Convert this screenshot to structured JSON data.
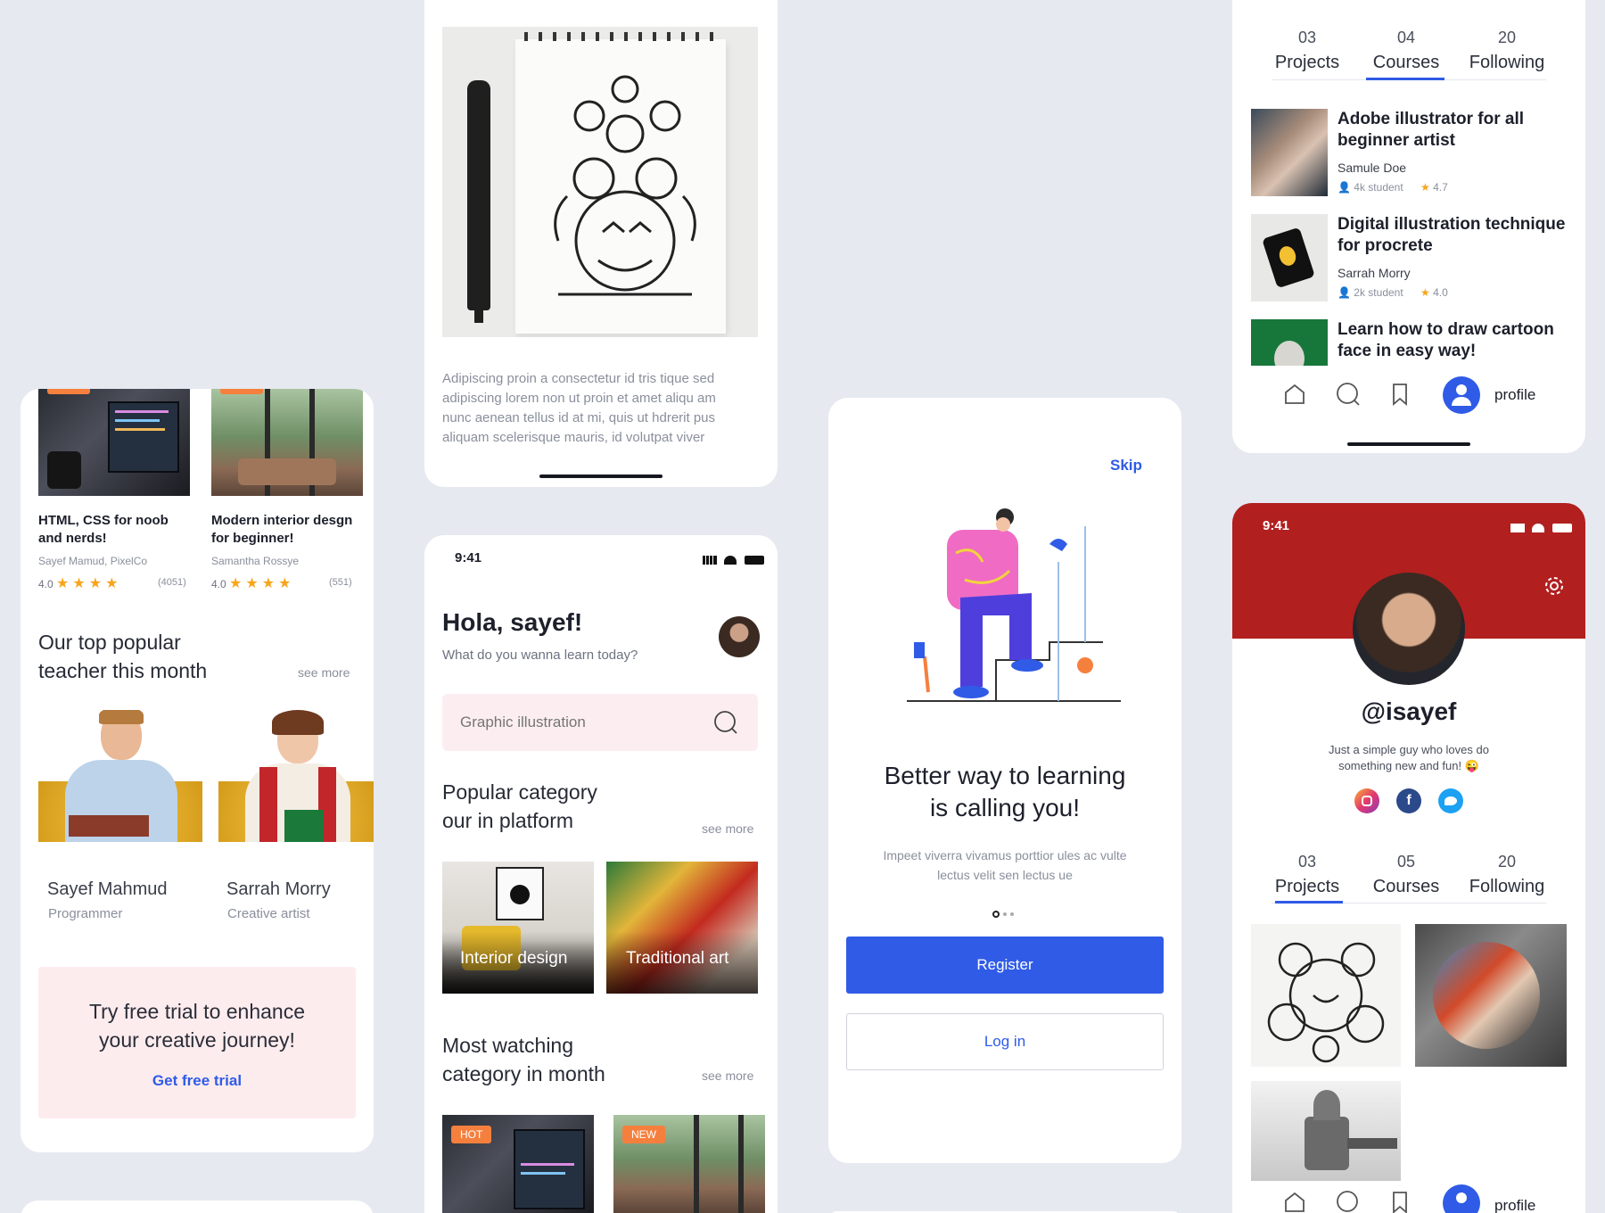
{
  "colors": {
    "accent": "#2f5be7",
    "badge": "#f5803e",
    "star": "#f7a51c",
    "profile_red": "#b21f1f",
    "trial_bg": "#fdecee"
  },
  "card1": {
    "courses": [
      {
        "title_l1": "HTML, CSS for noob",
        "title_l2": "and nerds!",
        "author": "Sayef Mamud, PixelCo",
        "rating": "4.0",
        "count": "(4051)"
      },
      {
        "title_l1": "Modern interior desgn",
        "title_l2": "for beginner!",
        "author": "Samantha Rossye",
        "rating": "4.0",
        "count": "(551)"
      }
    ],
    "section_title_l1": "Our top popular",
    "section_title_l2": "teacher this month",
    "see_more": "see more",
    "teachers": [
      {
        "name": "Sayef Mahmud",
        "role": "Programmer"
      },
      {
        "name": "Sarrah Morry",
        "role": "Creative artist"
      }
    ],
    "trial_l1": "Try free trial to enhance",
    "trial_l2": "your creative journey!",
    "trial_cta": "Get free trial"
  },
  "card2": {
    "description_l1": "Adipiscing proin a consectetur id tris tique sed",
    "description_l2": "adipiscing lorem non ut proin et amet aliqu am",
    "description_l3": "nunc aenean tellus id at mi, quis ut hdrerit pus",
    "description_l4": "aliquam scelerisque mauris, id volutpat viver"
  },
  "card3": {
    "status_time": "9:41",
    "greeting": "Hola, sayef!",
    "subtitle": "What do you wanna learn today?",
    "search_placeholder": "Graphic illustration",
    "popular_l1": "Popular category",
    "popular_l2": "our  in platform",
    "see_more": "see more",
    "categories": [
      "Interior design",
      "Traditional art"
    ],
    "watching_l1": "Most watching",
    "watching_l2": "category in month",
    "badges": [
      "HOT",
      "NEW"
    ]
  },
  "card4": {
    "skip": "Skip",
    "headline_l1": "Better way to learning",
    "headline_l2": "is calling you!",
    "body_l1": "Impeet viverra vivamus porttior ules ac vulte",
    "body_l2": "lectus velit sen lectus ue",
    "register": "Register",
    "login": "Log in"
  },
  "card5": {
    "tabs": [
      {
        "num": "03",
        "label": "Projects"
      },
      {
        "num": "04",
        "label": "Courses"
      },
      {
        "num": "20",
        "label": "Following"
      }
    ],
    "courses": [
      {
        "title_l1": "Adobe illustrator for all",
        "title_l2": "beginner artist",
        "author": "Samule Doe",
        "students": "4k student",
        "rating": "4.7"
      },
      {
        "title_l1": "Digital illustration technique",
        "title_l2": "for procrete",
        "author": "Sarrah Morry",
        "students": "2k student",
        "rating": "4.0"
      },
      {
        "title_l1": "Learn how to draw cartoon",
        "title_l2": "face in easy way!"
      }
    ],
    "nav_profile": "profile"
  },
  "card6": {
    "status_time": "9:41",
    "handle": "@isayef",
    "bio_l1": "Just a simple guy who loves do",
    "bio_l2": "something new and fun! 😜",
    "tabs": [
      {
        "num": "03",
        "label": "Projects"
      },
      {
        "num": "05",
        "label": "Courses"
      },
      {
        "num": "20",
        "label": "Following"
      }
    ],
    "nav_profile": "profile"
  }
}
